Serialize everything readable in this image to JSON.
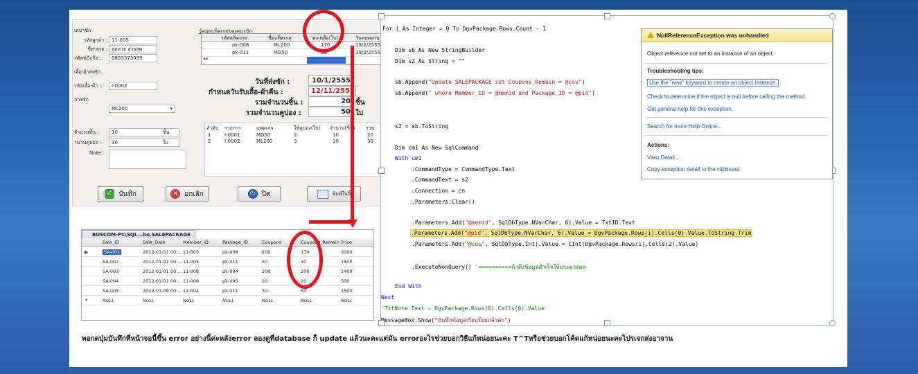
{
  "form": {
    "member_section": "เสมาชิก",
    "customer_code_label": "รหัสลูกค้า :",
    "customer_code": "11-005",
    "name_label": "ชื่อ-สกุล :",
    "name": "สุดสวย สวยสุด",
    "phone_label": "รศัพท์มือถือ :",
    "phone": "0893373999",
    "shirt_section": "เสื้อ-ผ้าส่งซัก",
    "shirt_code_label": "รหัสเสื้อ-ผ้า :",
    "shirt_code": "I-0002",
    "wash_label": "การซัก",
    "wash_select": "ML200",
    "qty_label": "จำนวนชิ้น :",
    "qty": "10",
    "qty_unit": "ชิ้น",
    "coupon_label": "านวนคูปอง :",
    "coupon": "30",
    "coupon_unit": "ใบ",
    "note_label": "Note :",
    "note_value": "",
    "pkg_table_title": "ข้อมูลแพ็คเกจของสมาชิก",
    "pkg_headers": [
      "รหัสแพ็คเกจ",
      "ชื่อแพ็คเกจ",
      "คงเหลือ(ใบ)",
      "วันหมดอายุ"
    ],
    "pkg_rows": [
      [
        "pk-008",
        "ML200",
        "170",
        "19/2/2555"
      ],
      [
        "pk-011",
        "MD50",
        "30",
        "19/2/2555"
      ]
    ],
    "new_row_marker": "**",
    "send_date_label": "วันที่ส่งซัก :",
    "send_date": "10/1/2555",
    "pickup_date_label": "กำหนดวันรับเสื้อ-ผ้าคืน :",
    "pickup_date": "12/11/2555",
    "total_qty_label": "รวมจำนวนชิ้น :",
    "total_qty": "20",
    "total_qty_unit": "ชิ้น",
    "total_coupon_label": "รวมจำนวนคูปอง :",
    "total_coupon": "50",
    "total_coupon_unit": "ใบ",
    "items_headers": [
      "ลำดับ",
      "รายการ",
      "แพคเกจ",
      "ใช้คูปอง(ใบ)",
      "จำนวน(ชิ้น)",
      "รวม"
    ],
    "items_rows": [
      [
        "1",
        "I-0001",
        "MD50",
        "2",
        "10",
        "20"
      ],
      [
        "2",
        "I-0002",
        "ML200",
        "3",
        "10",
        "30"
      ]
    ],
    "btn_save": "บันทึก",
    "btn_cancel": "ยกเลิก",
    "btn_close": "ปิด",
    "btn_print": "พิมพ์ใบนี้"
  },
  "grid": {
    "tab": "BUSCOM-PC\\SQL...bo.SALEPACKAGE",
    "headers": [
      "Sale_ID",
      "Sale_Date",
      "Member_ID",
      "Package_ID",
      "Coupons",
      "Coupons_Remain",
      "Price"
    ],
    "rows": [
      [
        "SA-001",
        "2012-01-01 00:...",
        "11-005",
        "pk-008",
        "200",
        "170",
        "3000"
      ],
      [
        "SA-002",
        "2012-01-01 00:...",
        "11-005",
        "pk-011",
        "50",
        "30",
        "1500"
      ],
      [
        "SA-003",
        "2012-01-01 00:...",
        "11-008",
        "pk-004",
        "200",
        "200",
        "2400"
      ],
      [
        "SA-004",
        "2012-01-01 00:...",
        "11-008",
        "pk-005",
        "20",
        "20",
        "500"
      ],
      [
        "SA-005",
        "2012-01-09 00:...",
        "11-004",
        "pk-011",
        "50",
        "50",
        "1500"
      ],
      [
        "NULL",
        "NULL",
        "NULL",
        "NULL",
        "NULL",
        "NULL",
        "NULL"
      ]
    ],
    "current_marker": "▶",
    "new_marker": "*"
  },
  "code": {
    "l1a": "For i As Integer = 0 To DgvPackage.Rows.Count - 1",
    "l2": "Dim sb As New StringBuilder",
    "l3": "Dim s2 As String = \"\"",
    "l4a": "sb.Append(",
    "l4b": "\"Update SALEPACKAGE set Coupons_Remain = @cou\"",
    "l4c": ")",
    "l5a": "sb.Append(",
    "l5b": "\" where Member_ID = @memid and Package_ID = @pid\"",
    "l5c": ")",
    "l6": "s2 = sb.ToString",
    "l7": "Dim cm1 As New SqlCommand",
    "l8": "With cm1",
    "l9": ".CommandType = CommandType.Text",
    "l10": ".CommandText = s2",
    "l11": ".Connection = cn",
    "l12": ".Parameters.Clear()",
    "l13a": ".Parameters.Add(",
    "l13b": "\"@memid\"",
    "l13c": ", SqlDbType.NVarChar, 6).Value = TxtID.Text",
    "l14a": ".Parameters.Add(",
    "l14b": "\"@pid\"",
    "l14c": ", SqlDbType.NVarChar, 6).Value = DgvPackage.Rows(i).Cells(0).Value.ToString.Trim",
    "l15a": ".Parameters.Add(",
    "l15b": "\"@cou\"",
    "l15c": ", SqlDbType.Int).Value = CInt(DgvPackage.Rows(i).Cells(2).Value)",
    "l16a": ".ExecuteNonQuery()",
    "l16b": " '==========ถ้าดึงข้อมูลสำเร็จให้ประมวลผล",
    "l17": "End With",
    "l18": "Next",
    "l19": "'TxtNote.Text = DgvPackage.Rows(0).Cells(0).Value",
    "l20a": "MessageBox.Show(",
    "l20b": "\"บันทึกข้อมูลเรียบร้อยแล้วค่ะ\"",
    "l20c": ")"
  },
  "exception": {
    "title": "NullReferenceException was unhandled",
    "message": "Object reference not set to an instance of an object.",
    "tips_heading": "Troubleshooting tips:",
    "tip1": "Use the \"new\" keyword to create an object instance.",
    "tip2": "Check to determine if the object is null before calling the method.",
    "tip3": "Get general help for this exception.",
    "search": "Search for more Help Online...",
    "actions_heading": "Actions:",
    "action1": "View Detail...",
    "action2": "Copy exception detail to the clipboard"
  },
  "caption": "พอกดปุ่มบันทึกที่หน้าจอนี้ขึ้น error อย่างนี้ค่ะหลังerror ลองดูที่database ก็ update แล้วนะคะแต่มัน errorอะไรช่วยบอกวิธีแก้หน่อยนะคะ T^Tหรือช่วยบอกโค้ดแก้หน่อยนะคะไปรเจกส่งอาจาน",
  "colors": {
    "background": "#2a66b0",
    "annotation": "#e8121a",
    "highlight": "#fbe88a",
    "link": "#1a56b8"
  }
}
